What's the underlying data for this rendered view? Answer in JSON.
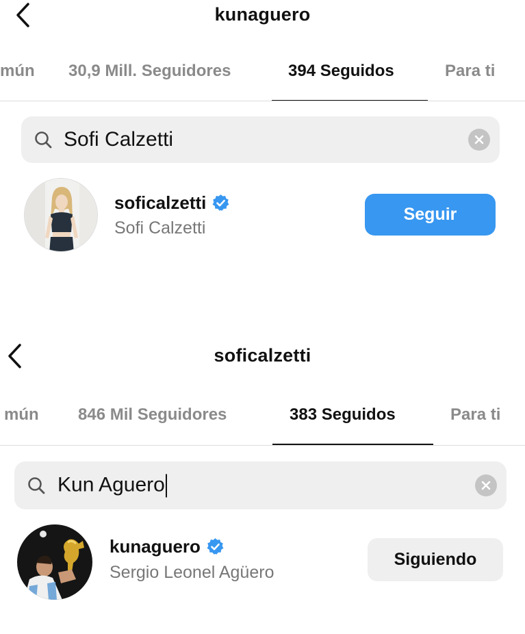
{
  "screen1": {
    "title": "kunaguero",
    "tabs": [
      {
        "label": "mún",
        "active": false
      },
      {
        "label": "30,9 Mill. Seguidores",
        "active": false
      },
      {
        "label": "394 Seguidos",
        "active": true
      },
      {
        "label": "Para ti",
        "active": false
      }
    ],
    "search_query": "Sofi Calzetti",
    "result": {
      "username": "soficalzetti",
      "verified": true,
      "full_name": "Sofi Calzetti",
      "button_label": "Seguir"
    }
  },
  "screen2": {
    "title": "soficalzetti",
    "tabs": [
      {
        "label": "mún",
        "active": false
      },
      {
        "label": "846 Mil Seguidores",
        "active": false
      },
      {
        "label": "383 Seguidos",
        "active": true
      },
      {
        "label": "Para ti",
        "active": false
      }
    ],
    "search_query": "Kun Aguero",
    "result": {
      "username": "kunaguero",
      "verified": true,
      "full_name": "Sergio Leonel Agüero",
      "button_label": "Siguiendo"
    }
  },
  "colors": {
    "accent": "#3897f0",
    "verified": "#3897f0",
    "tab_inactive": "#8a8a8a",
    "search_bg": "#efefef"
  },
  "icons": [
    "back-chevron-icon",
    "search-icon",
    "clear-icon",
    "verified-badge-icon"
  ]
}
